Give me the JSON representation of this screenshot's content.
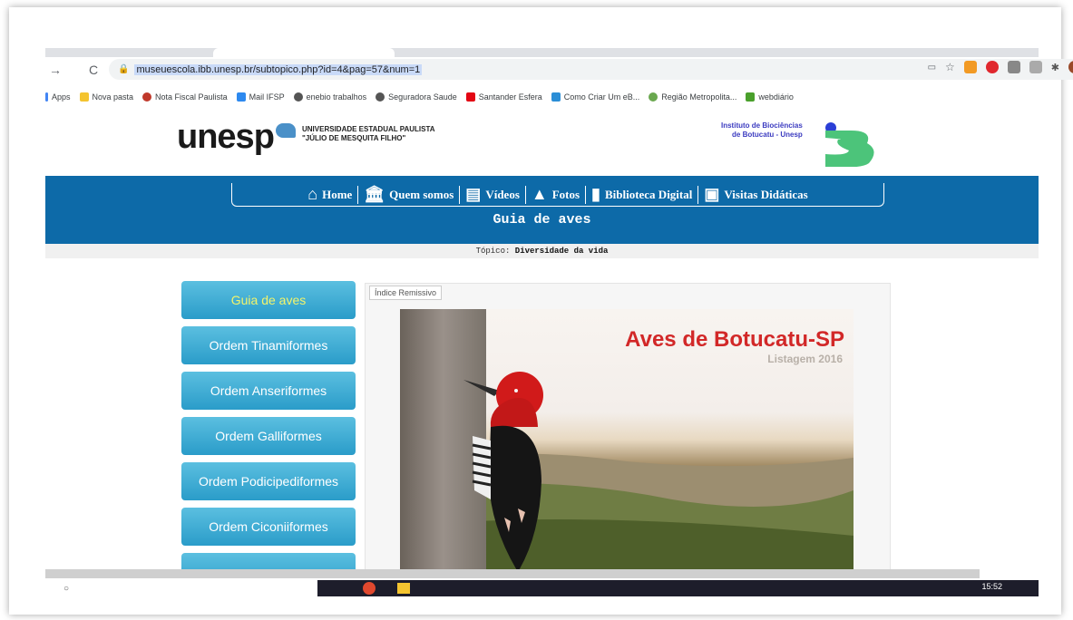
{
  "browser": {
    "url": "museuescola.ibb.unesp.br/subtopico.php?id=4&pag=57&num=1",
    "bookmarks": [
      "Apps",
      "Nova pasta",
      "Nota Fiscal Paulista",
      "Mail IFSP",
      "enebio trabalhos",
      "Seguradora Saude",
      "Santander Esfera",
      "Como Criar Um eB...",
      "Região Metropolita...",
      "webdiário"
    ]
  },
  "header": {
    "logo": "unesp",
    "university_line1": "UNIVERSIDADE ESTADUAL PAULISTA",
    "university_line2": "\"JÚLIO DE MESQUITA FILHO\"",
    "institute_line1": "Instituto de Biociências",
    "institute_line2": "de Botucatu - Unesp"
  },
  "nav": {
    "items": [
      "Home",
      "Quem somos",
      "Vídeos",
      "Fotos",
      "Biblioteca Digital",
      "Visitas Didáticas"
    ]
  },
  "page": {
    "title": "Guia de aves",
    "topic_label": "Tópico:",
    "topic_value": "Diversidade da vida"
  },
  "sidebar": {
    "items": [
      "Guia de aves",
      "Ordem Tinamiformes",
      "Ordem Anseriformes",
      "Ordem Galliformes",
      "Ordem Podicipediformes",
      "Ordem Ciconiiformes"
    ]
  },
  "content": {
    "index_tab": "Índice Remissivo",
    "banner_title": "Aves de Botucatu-SP",
    "banner_subtitle": "Listagem 2016"
  },
  "taskbar": {
    "clock": "15:52"
  },
  "colors": {
    "nav_blue": "#0d6aa8",
    "sidebar_button": "#2a9cc9",
    "banner_title": "#d22828"
  }
}
